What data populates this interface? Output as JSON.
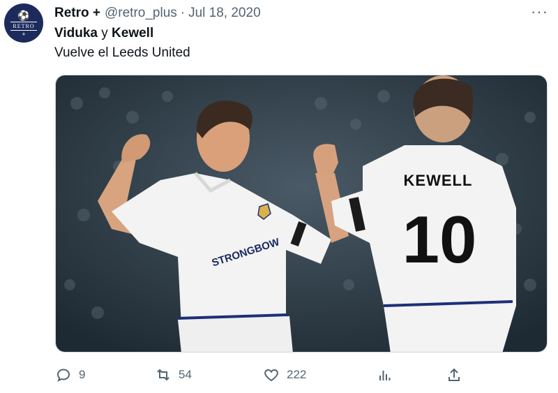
{
  "avatar": {
    "wordmark": "RETRO",
    "plus": "+"
  },
  "tweet": {
    "author_name": "Retro +",
    "author_handle": "@retro_plus",
    "separator": "·",
    "date": "Jul 18, 2020",
    "more_label": "···",
    "line1": {
      "name1": "Viduka",
      "conj": "y",
      "name2": "Kewell"
    },
    "line2": "Vuelve el Leeds United"
  },
  "media": {
    "shirt_sponsor": "STRONGBOW",
    "shirt_name": "KEWELL",
    "shirt_number": "10",
    "colors": {
      "kit": "#f2f3f2",
      "trim": "#1e2f78",
      "crowd": "#2e3e4c"
    }
  },
  "actions": {
    "replies": "9",
    "retweets": "54",
    "likes": "222"
  },
  "icons": [
    "reply-icon",
    "retweet-icon",
    "like-icon",
    "views-icon",
    "share-icon",
    "more-icon"
  ]
}
